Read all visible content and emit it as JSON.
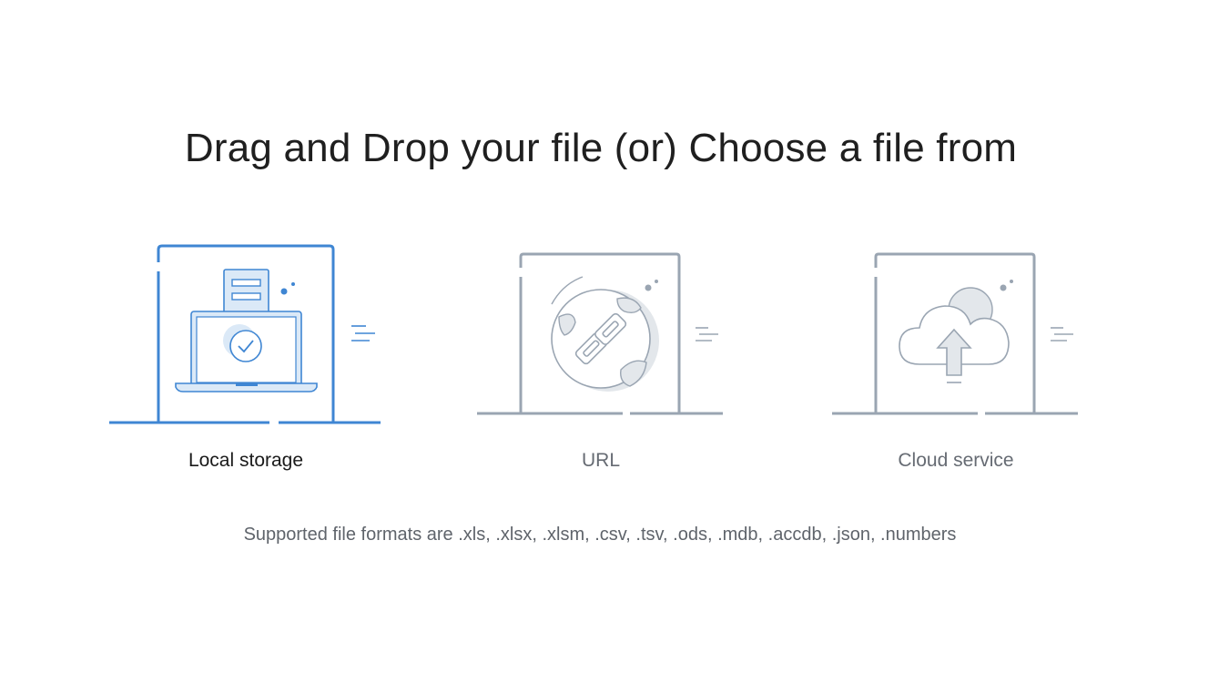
{
  "heading": "Drag and Drop your file (or) Choose a file from",
  "options": [
    {
      "label": "Local storage",
      "icon": "laptop-upload-icon",
      "selected": true
    },
    {
      "label": "URL",
      "icon": "globe-link-icon",
      "selected": false
    },
    {
      "label": "Cloud service",
      "icon": "cloud-upload-icon",
      "selected": false
    }
  ],
  "supported_formats": "Supported file formats are .xls, .xlsx, .xlsm, .csv, .tsv, .ods, .mdb, .accdb, .json, .numbers",
  "colors": {
    "accent": "#3f86d3",
    "icon_gray": "#9aa5b2",
    "accent_fill": "#dbe9f7",
    "gray_fill": "#e3e7eb"
  }
}
